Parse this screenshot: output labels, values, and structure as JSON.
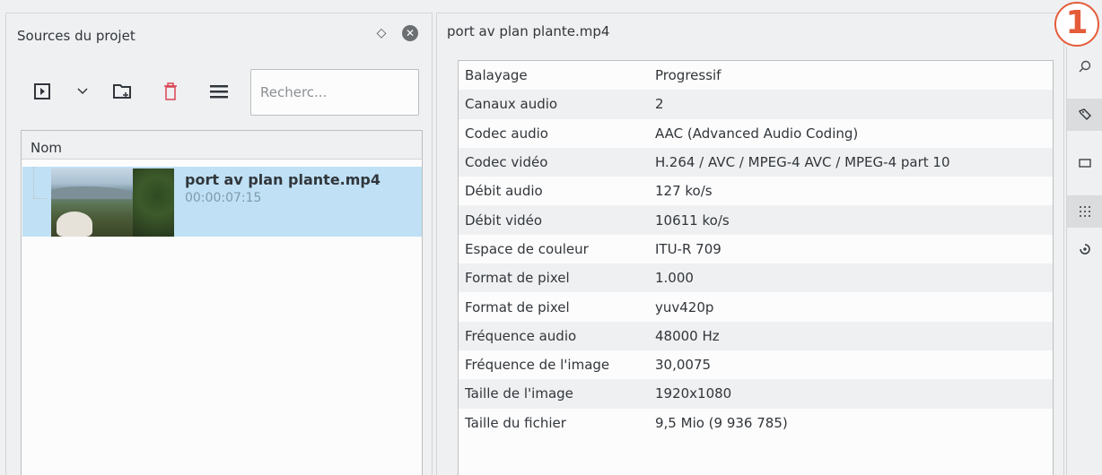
{
  "left_panel": {
    "title": "Sources du projet",
    "search_placeholder": "Recherc...",
    "list_header": "Nom",
    "clip": {
      "name": "port av plan plante.mp4",
      "duration": "00:00:07:15"
    }
  },
  "right_panel": {
    "title": "port av plan plante.mp4",
    "properties": [
      {
        "key": "Balayage",
        "value": "Progressif"
      },
      {
        "key": "Canaux audio",
        "value": "2"
      },
      {
        "key": "Codec audio",
        "value": "AAC (Advanced Audio Coding)"
      },
      {
        "key": "Codec vidéo",
        "value": "H.264 / AVC / MPEG-4 AVC / MPEG-4 part 10"
      },
      {
        "key": "Débit audio",
        "value": "127 ko/s"
      },
      {
        "key": "Débit vidéo",
        "value": "10611 ko/s"
      },
      {
        "key": "Espace de couleur",
        "value": "ITU-R 709"
      },
      {
        "key": "Format de pixel",
        "value": "1.000"
      },
      {
        "key": "Format de pixel",
        "value": "yuv420p"
      },
      {
        "key": "Fréquence audio",
        "value": "48000 Hz"
      },
      {
        "key": "Fréquence de l'image",
        "value": "30,0075"
      },
      {
        "key": "Taille de l'image",
        "value": "1920x1080"
      },
      {
        "key": "Taille du fichier",
        "value": "9,5 Mio (9 936 785)"
      }
    ]
  },
  "sidebar_icons": [
    "search-icon",
    "tag-icon",
    "rectangle-icon",
    "dots-grid-icon",
    "audio-spiral-icon"
  ],
  "badge": "1",
  "colors": {
    "selection": "#bfe0f5",
    "delete_red": "#da4453",
    "badge_orange": "#e45c39"
  }
}
